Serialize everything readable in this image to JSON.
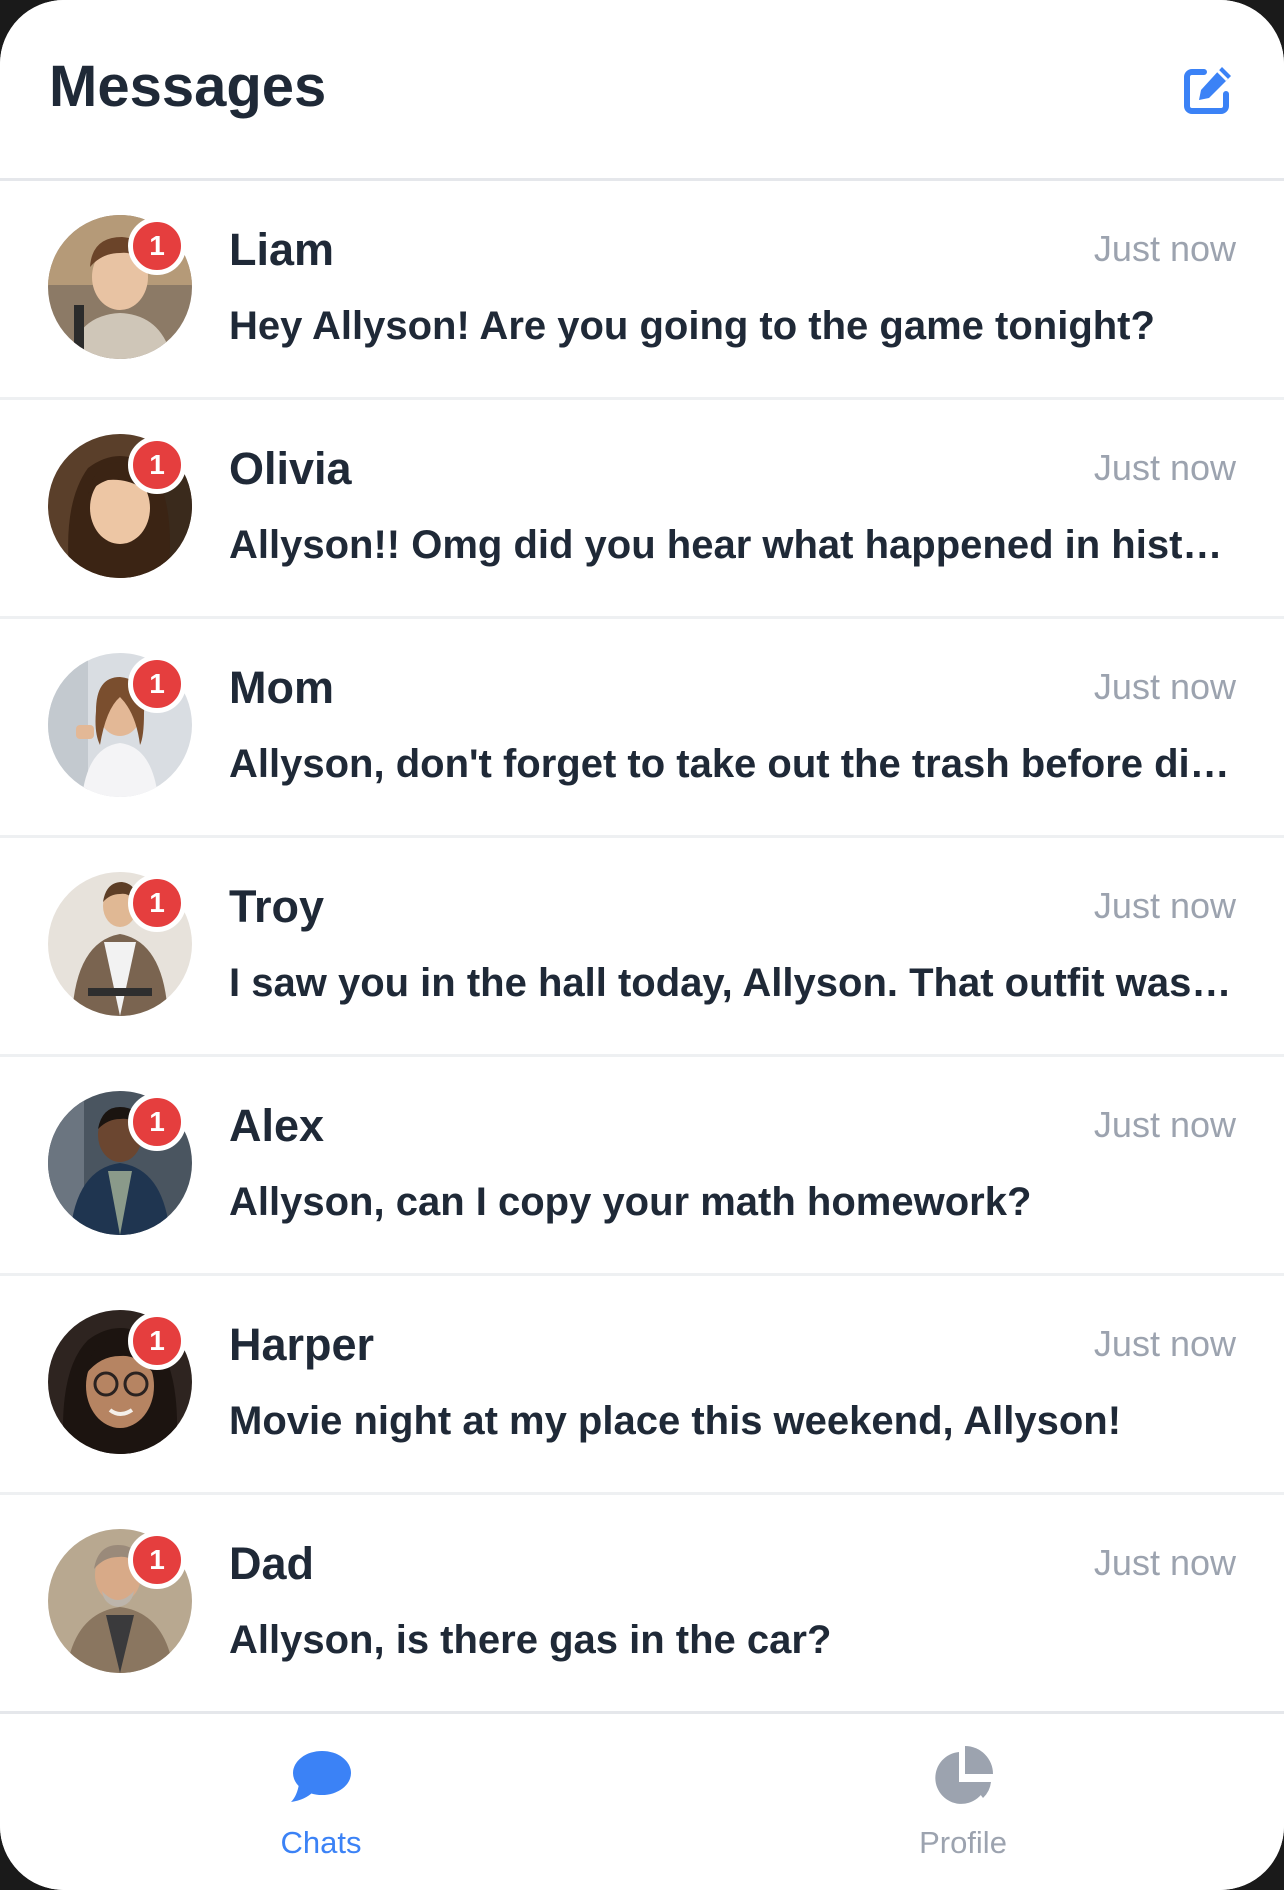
{
  "header": {
    "title": "Messages",
    "compose_icon": "edit-icon"
  },
  "colors": {
    "accent": "#3b82f6",
    "badge": "#e53e3e",
    "text": "#1f2937",
    "muted": "#9ca3af"
  },
  "conversations": [
    {
      "name": "Liam",
      "time": "Just now",
      "preview": "Hey Allyson! Are you going to the game tonight?",
      "unread": "1"
    },
    {
      "name": "Olivia",
      "time": "Just now",
      "preview": "Allyson!! Omg did you hear what happened in history class today?",
      "unread": "1"
    },
    {
      "name": "Mom",
      "time": "Just now",
      "preview": "Allyson, don't forget to take out the trash before dinner!",
      "unread": "1"
    },
    {
      "name": "Troy",
      "time": "Just now",
      "preview": "I saw you in the hall today, Allyson. That outfit was really cute.",
      "unread": "1"
    },
    {
      "name": "Alex",
      "time": "Just now",
      "preview": "Allyson, can I copy your math homework?",
      "unread": "1"
    },
    {
      "name": "Harper",
      "time": "Just now",
      "preview": "Movie night at my place this weekend, Allyson!",
      "unread": "1"
    },
    {
      "name": "Dad",
      "time": "Just now",
      "preview": "Allyson, is there gas in the car?",
      "unread": "1"
    }
  ],
  "tabs": [
    {
      "label": "Chats",
      "icon": "chat-bubble-icon",
      "active": true
    },
    {
      "label": "Profile",
      "icon": "pie-chart-icon",
      "active": false
    }
  ]
}
